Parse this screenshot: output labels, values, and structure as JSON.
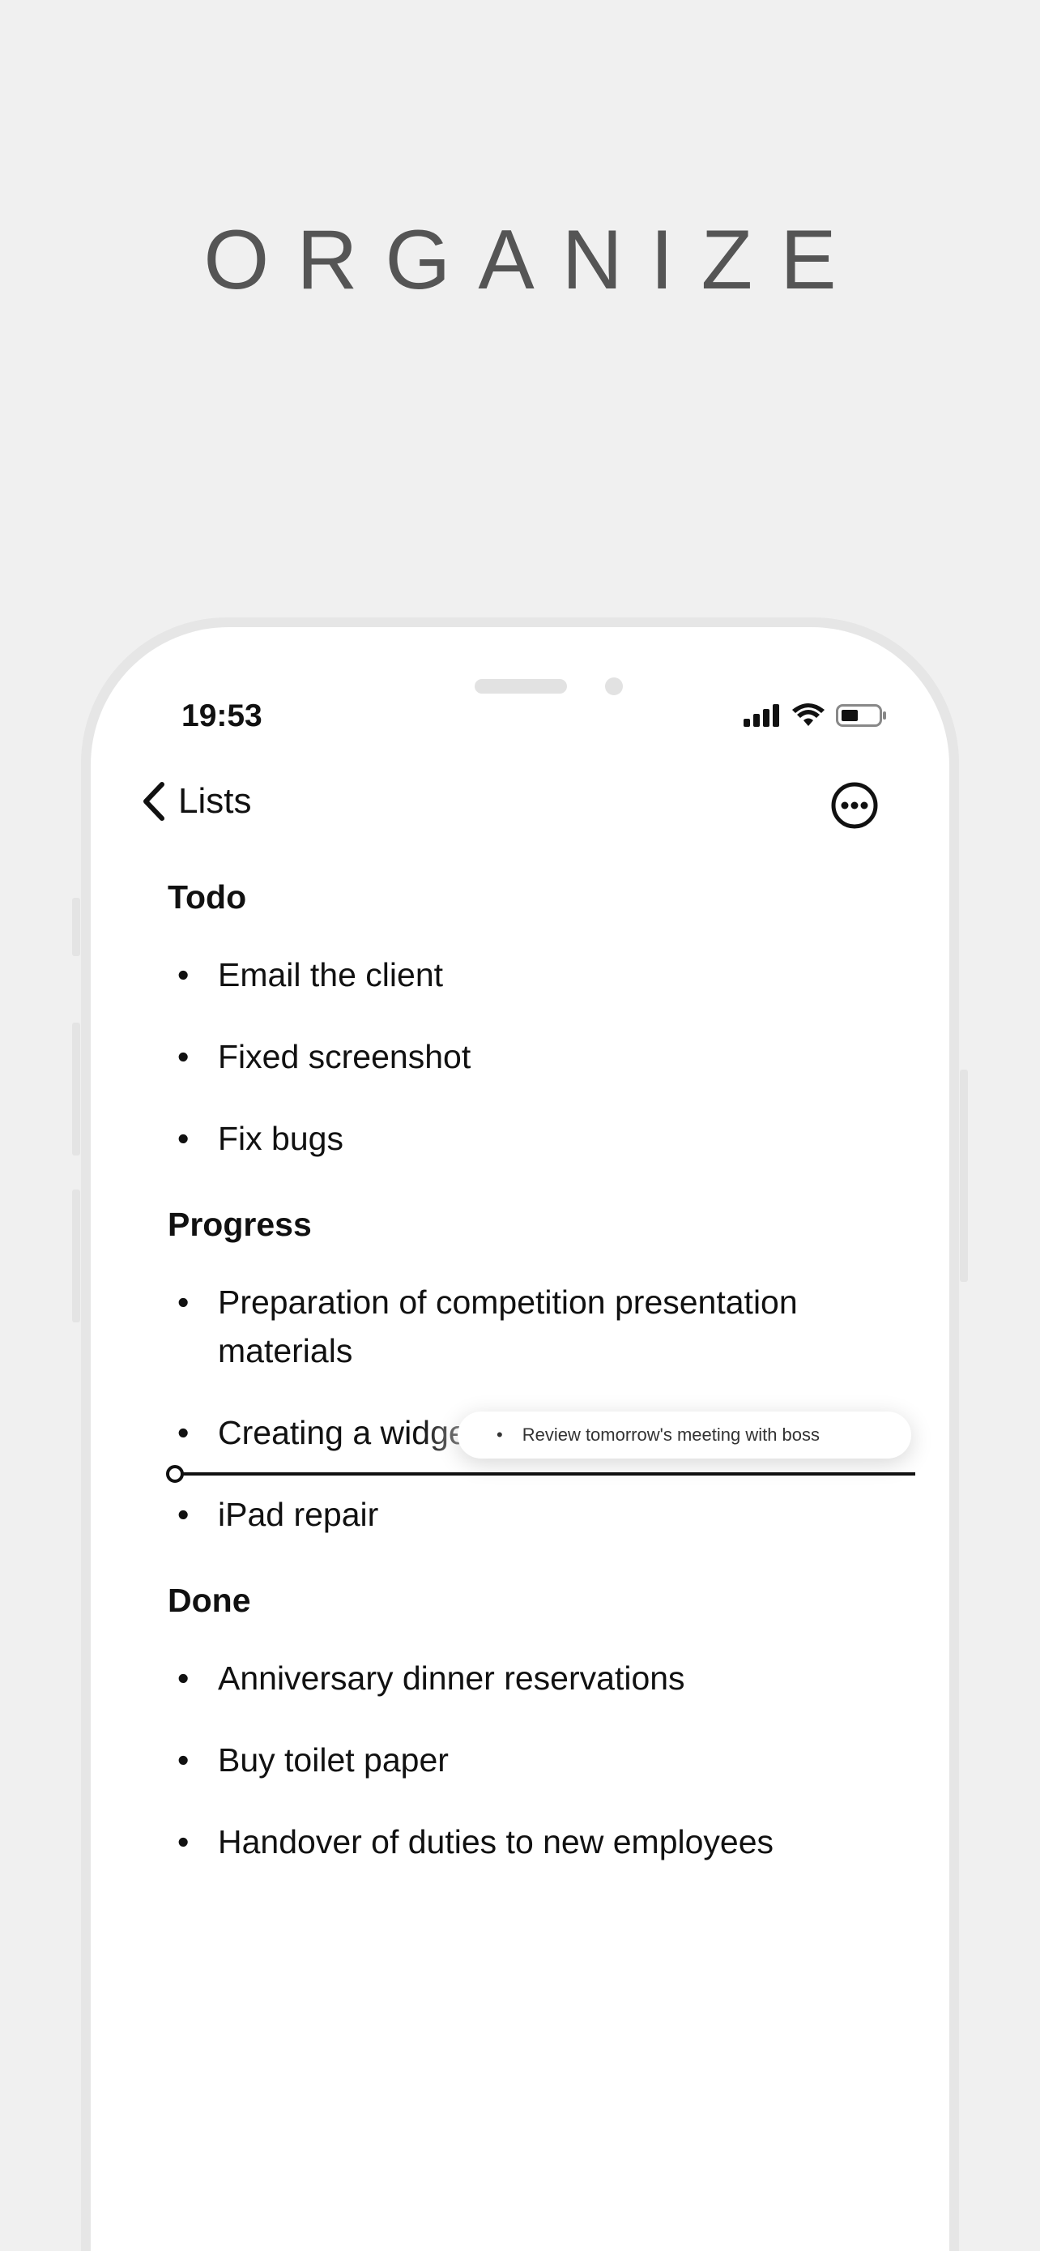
{
  "headline": "ORGANIZE",
  "status_bar": {
    "time": "19:53",
    "icons": [
      "cellular-signal-icon",
      "wifi-icon",
      "battery-icon"
    ]
  },
  "nav": {
    "back_label": "Lists",
    "back_icon": "chevron-left-icon",
    "more_icon": "ellipsis-circle-icon"
  },
  "sections": [
    {
      "title": "Todo",
      "items": [
        "Email the client",
        "Fixed screenshot",
        "Fix bugs"
      ]
    },
    {
      "title": "Progress",
      "items": [
        "Preparation of competition presentation materials",
        "Creating a widget",
        "iPad repair"
      ]
    },
    {
      "title": "Done",
      "items": [
        "Anniversary dinner reservations",
        "Buy toilet paper",
        "Handover of duties to new employees"
      ]
    }
  ],
  "dragging_item": "Review tomorrow's meeting with boss",
  "bullet": "•",
  "colors": {
    "background": "#f0f0f0",
    "screen": "#ffffff",
    "text": "#111111",
    "headline": "#555555"
  }
}
